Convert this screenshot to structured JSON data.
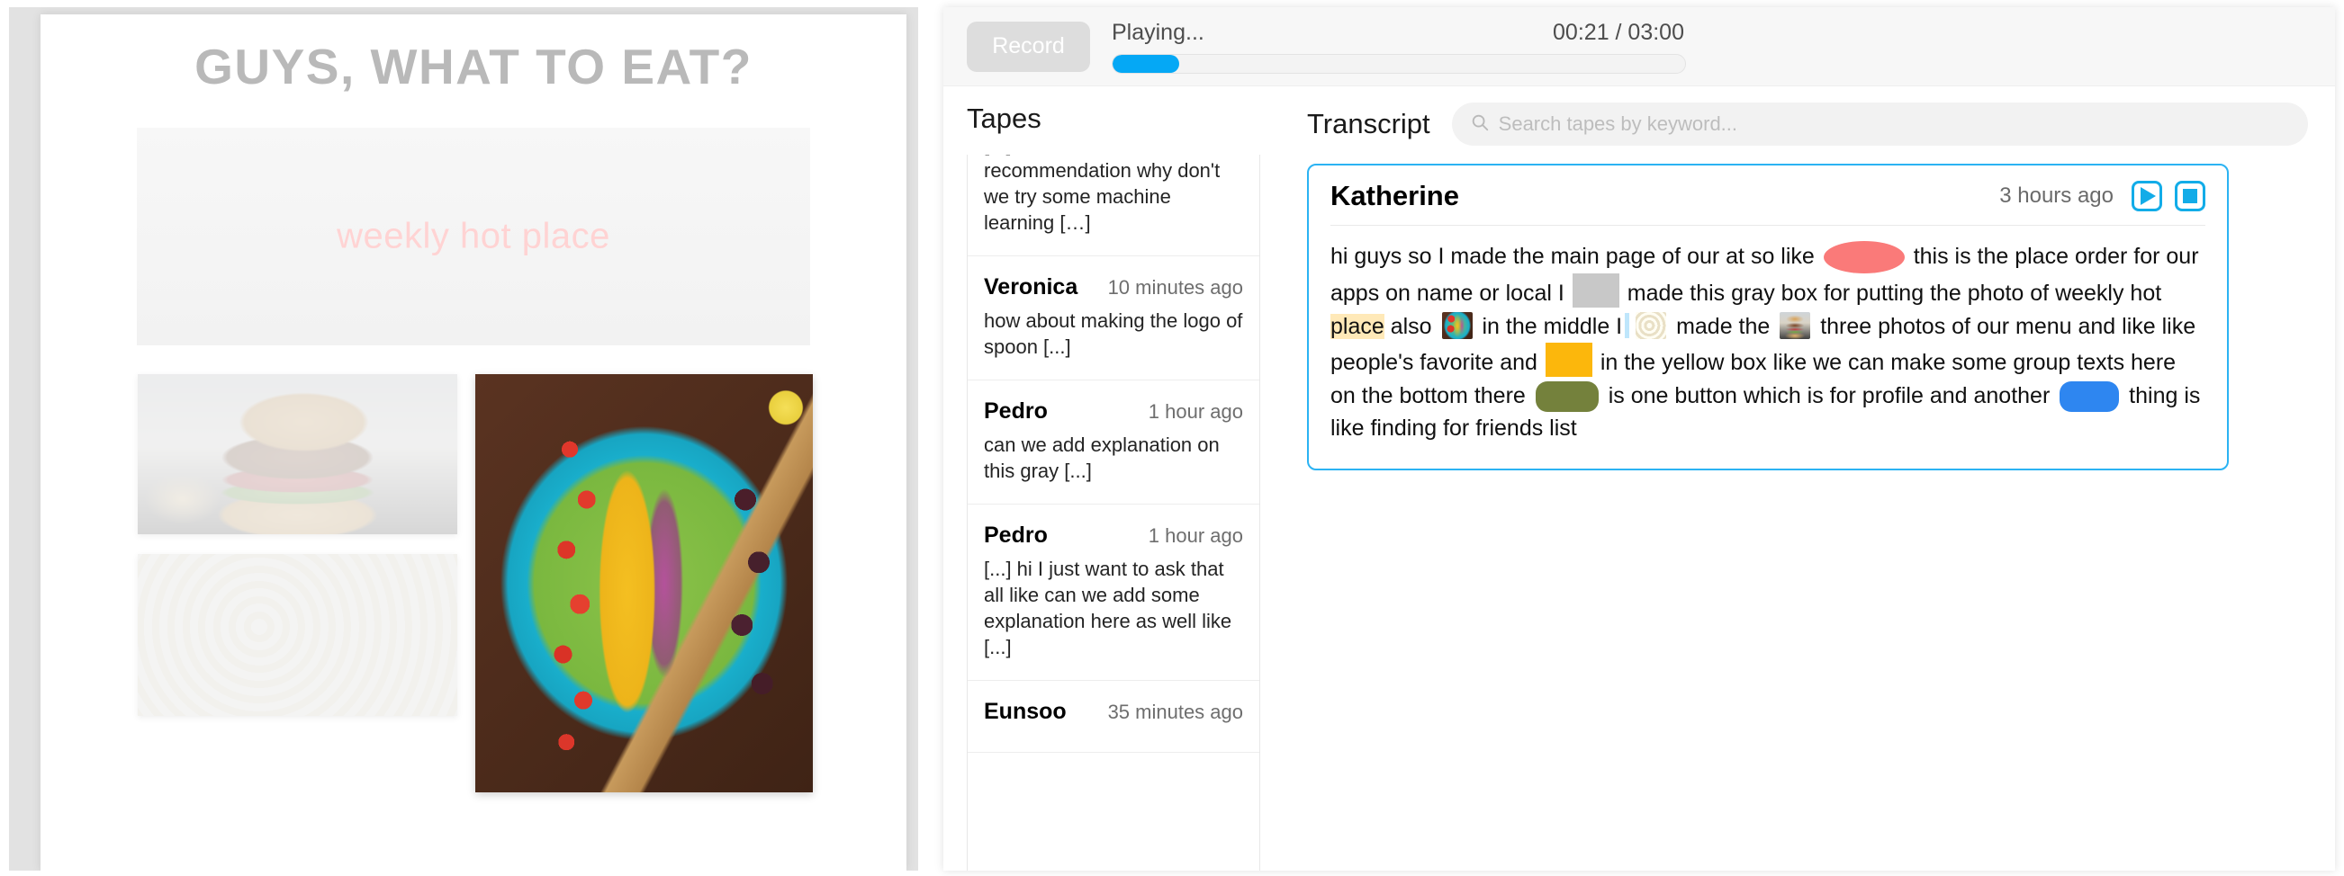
{
  "mockup": {
    "title": "GUYS, WHAT TO EAT?",
    "hero_label": "weekly hot place",
    "images": [
      {
        "name": "burger-photo"
      },
      {
        "name": "pasta-photo"
      },
      {
        "name": "salad-photo"
      }
    ]
  },
  "toolbar": {
    "record_label": "Record",
    "status": "Playing...",
    "time": "00:21 / 03:00",
    "progress_percent": 11.7,
    "accent_color": "#05a8f5"
  },
  "tapes": {
    "heading": "Tapes",
    "items": [
      {
        "name": "",
        "time": "",
        "text": "[...] for a better recommendation why don't we try some machine learning […]"
      },
      {
        "name": "Veronica",
        "time": "10 minutes ago",
        "text": "how about making the logo of spoon [...]"
      },
      {
        "name": "Pedro",
        "time": "1 hour ago",
        "text": "can we add explanation on this gray [...]"
      },
      {
        "name": "Pedro",
        "time": "1 hour ago",
        "text": "[...] hi I just want to ask that all like can we add some explanation here as well like [...]"
      },
      {
        "name": "Eunsoo",
        "time": "35 minutes ago",
        "text": ""
      }
    ]
  },
  "transcript": {
    "heading": "Transcript",
    "search_placeholder": "Search tapes by keyword...",
    "search_value": "",
    "card": {
      "speaker": "Katherine",
      "time": "3 hours ago",
      "play_label": "play-icon",
      "stop_label": "stop-icon",
      "border_color": "#2bb3f3",
      "segments": [
        {
          "type": "text",
          "value": "hi guys so I made the main page of our at so like "
        },
        {
          "type": "blob",
          "style": "pink"
        },
        {
          "type": "text",
          "value": " this is the place order for our apps on name or local I "
        },
        {
          "type": "blob",
          "style": "gray"
        },
        {
          "type": "text",
          "value": " made this gray box for putting the photo of weekly hot "
        },
        {
          "type": "highlight",
          "value": "place"
        },
        {
          "type": "text",
          "value": " also "
        },
        {
          "type": "chip",
          "style": "salad"
        },
        {
          "type": "text",
          "value": " in the middle I"
        },
        {
          "type": "caret"
        },
        {
          "type": "chip",
          "style": "pasta"
        },
        {
          "type": "text",
          "value": " made the "
        },
        {
          "type": "chip",
          "style": "burger"
        },
        {
          "type": "text",
          "value": " three photos of our menu and like like people's favorite and "
        },
        {
          "type": "blob",
          "style": "orange"
        },
        {
          "type": "text",
          "value": " in the yellow box like we can make some group texts here on the bottom there "
        },
        {
          "type": "blob",
          "style": "olive"
        },
        {
          "type": "text",
          "value": " is one button which is for profile and another "
        },
        {
          "type": "blob",
          "style": "blue"
        },
        {
          "type": "text",
          "value": " thing is like finding for friends list"
        }
      ]
    }
  }
}
